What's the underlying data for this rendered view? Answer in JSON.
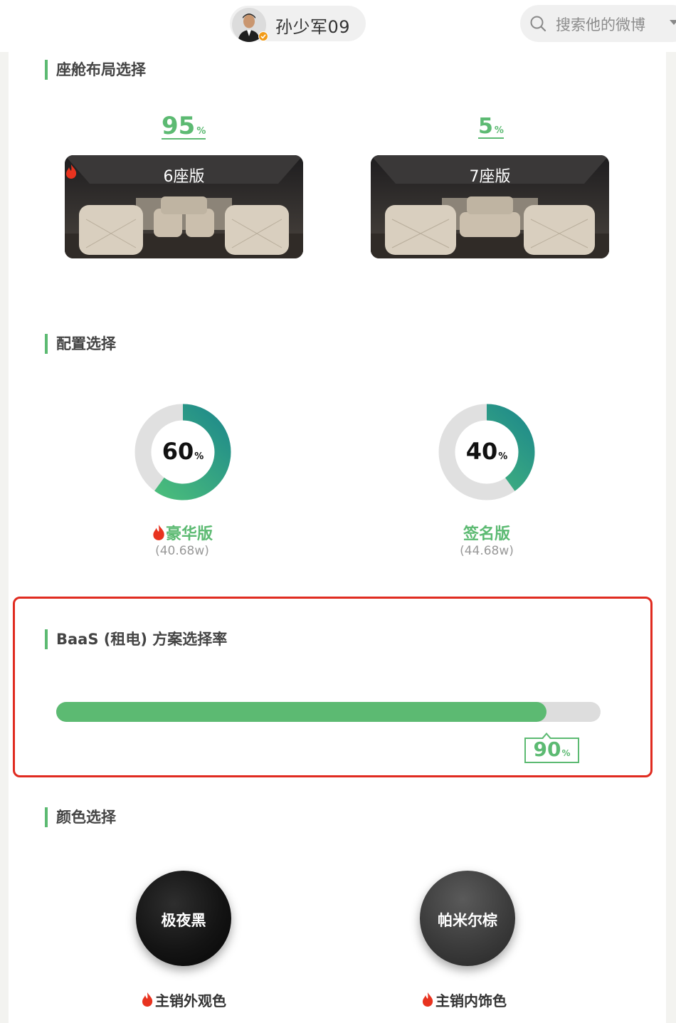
{
  "header": {
    "username": "孙少军09",
    "search_placeholder": "搜索他的微博",
    "avatar_icon": "avatar-photo"
  },
  "sections": {
    "cabin": {
      "title": "座舱布局选择",
      "options": [
        {
          "percent": "95",
          "unit": "%",
          "label": "6座版",
          "hot": true
        },
        {
          "percent": "5",
          "unit": "%",
          "label": "7座版",
          "hot": false
        }
      ]
    },
    "config": {
      "title": "配置选择",
      "options": [
        {
          "percent": "60",
          "unit": "%",
          "value": 0.6,
          "name": "豪华版",
          "price": "(40.68w)",
          "hot": true
        },
        {
          "percent": "40",
          "unit": "%",
          "value": 0.4,
          "name": "签名版",
          "price": "(44.68w)",
          "hot": false
        }
      ]
    },
    "baas": {
      "title": "BaaS (租电) 方案选择率",
      "percent": "90",
      "unit": "%",
      "value": 0.9
    },
    "color": {
      "title": "颜色选择",
      "options": [
        {
          "name": "极夜黑",
          "note": "主销外观色"
        },
        {
          "name": "帕米尔棕",
          "note": "主销内饰色"
        }
      ]
    }
  },
  "colors": {
    "accent": "#5cba72",
    "highlight_frame": "#e02b20",
    "flame": "#e8331f",
    "track": "#dddddd"
  }
}
